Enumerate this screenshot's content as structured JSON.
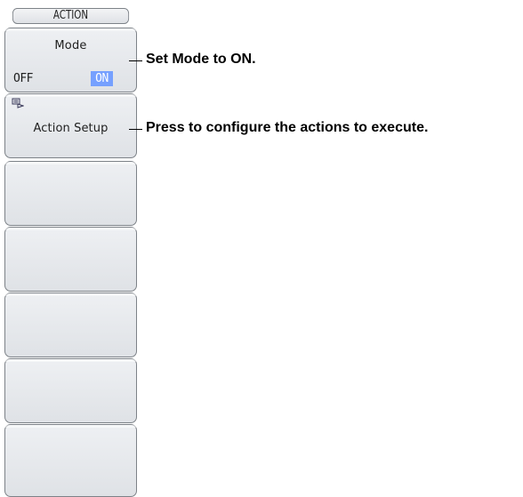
{
  "menu": {
    "title": "ACTION",
    "mode": {
      "label": "Mode",
      "options": [
        "OFF",
        "ON"
      ],
      "selected": "ON"
    },
    "action_setup": {
      "label": "Action Setup",
      "icon": "submenu-icon"
    },
    "empty_keys": 5
  },
  "annotations": {
    "mode": "Set Mode to ON.",
    "action_setup": "Press to configure the actions to execute."
  },
  "colors": {
    "selected_bg": "#76a0ff",
    "key_border": "#7d8288"
  }
}
